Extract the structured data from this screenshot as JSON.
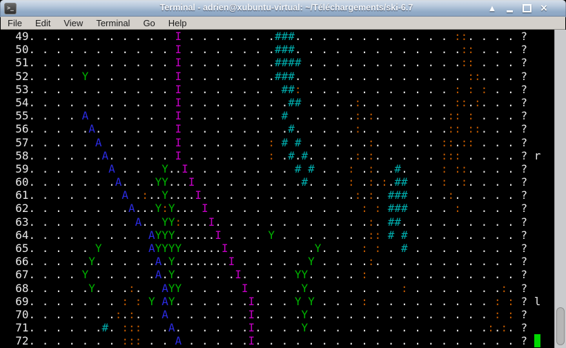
{
  "window": {
    "title": "Terminal - adrien@xubuntu-virtual: ~/Téléchargements/ski-6.7",
    "app_icon": "terminal-icon",
    "icon_glyph": ">_",
    "buttons": [
      "shade",
      "minimize",
      "maximize",
      "close"
    ]
  },
  "menu": {
    "items": [
      "File",
      "Edit",
      "View",
      "Terminal",
      "Go",
      "Help"
    ]
  },
  "terminal": {
    "palette": {
      "w": "#e8e8e8",
      "m": "#c400c4",
      "g": "#00b400",
      "b": "#2b2be0",
      "c": "#00adad",
      "o": "#c25a00",
      "cursor": "#00d800",
      "background": "#000000"
    },
    "legend": {
      "I": "skier",
      "A": "yeti",
      "Y": "tree",
      "#": "ice",
      ":": "bare-ground",
      ".": "snow",
      "?": "command-prompt"
    },
    "field": {
      "total_cols": 81,
      "num_width": 4,
      "dot_start": 4,
      "dot_end": 76,
      "snow_char": ".",
      "prompt_col": 78,
      "prompt_char": "?",
      "echo_col": 80
    },
    "rows": [
      {
        "num": 49,
        "cells": [
          [
            26,
            "m",
            "I"
          ],
          [
            41,
            "c",
            "###"
          ],
          [
            68,
            "o",
            "::"
          ]
        ]
      },
      {
        "num": 50,
        "cells": [
          [
            26,
            "m",
            "I"
          ],
          [
            41,
            "c",
            "###"
          ],
          [
            69,
            "o",
            "::"
          ]
        ]
      },
      {
        "num": 51,
        "cells": [
          [
            26,
            "m",
            "I"
          ],
          [
            41,
            "c",
            "####"
          ],
          [
            69,
            "o",
            "::"
          ]
        ]
      },
      {
        "num": 52,
        "cells": [
          [
            12,
            "g",
            "Y"
          ],
          [
            26,
            "m",
            "I"
          ],
          [
            41,
            "c",
            "###"
          ],
          [
            70,
            "o",
            "::"
          ]
        ]
      },
      {
        "num": 53,
        "cells": [
          [
            26,
            "m",
            "I"
          ],
          [
            42,
            "c",
            "##"
          ],
          [
            44,
            "o",
            ":"
          ],
          [
            68,
            "o",
            ":"
          ],
          [
            70,
            "o",
            ":"
          ],
          [
            72,
            "o",
            ":"
          ]
        ]
      },
      {
        "num": 54,
        "cells": [
          [
            26,
            "m",
            "I"
          ],
          [
            43,
            "c",
            "##"
          ],
          [
            53,
            "o",
            ":"
          ],
          [
            68,
            "o",
            "::"
          ],
          [
            71,
            "o",
            ":"
          ]
        ]
      },
      {
        "num": 55,
        "cells": [
          [
            12,
            "b",
            "A"
          ],
          [
            26,
            "m",
            "I"
          ],
          [
            42,
            "c",
            "#"
          ],
          [
            53,
            "o",
            ":"
          ],
          [
            55,
            "o",
            ":"
          ],
          [
            67,
            "o",
            "::"
          ],
          [
            70,
            "o",
            ":"
          ]
        ]
      },
      {
        "num": 56,
        "cells": [
          [
            13,
            "b",
            "A"
          ],
          [
            26,
            "m",
            "I"
          ],
          [
            43,
            "c",
            "#"
          ],
          [
            53,
            "o",
            ":"
          ],
          [
            67,
            "o",
            "::"
          ],
          [
            70,
            "o",
            "::"
          ]
        ]
      },
      {
        "num": 57,
        "cells": [
          [
            14,
            "b",
            "A"
          ],
          [
            26,
            "m",
            "I"
          ],
          [
            40,
            "o",
            ":"
          ],
          [
            42,
            "c",
            "#"
          ],
          [
            44,
            "c",
            "#"
          ],
          [
            55,
            "o",
            ":"
          ],
          [
            66,
            "o",
            "::"
          ],
          [
            69,
            "o",
            "::"
          ]
        ]
      },
      {
        "num": 58,
        "cells": [
          [
            15,
            "b",
            "A"
          ],
          [
            26,
            "m",
            "I"
          ],
          [
            40,
            "o",
            ":"
          ],
          [
            43,
            "c",
            "#"
          ],
          [
            45,
            "c",
            "#"
          ],
          [
            53,
            "o",
            ":"
          ],
          [
            55,
            "o",
            ":"
          ],
          [
            66,
            "o",
            "::"
          ],
          [
            68,
            "o",
            ":"
          ]
        ],
        "echo": "r"
      },
      {
        "num": 59,
        "cells": [
          [
            16,
            "b",
            "A"
          ],
          [
            24,
            "g",
            "Y"
          ],
          [
            25,
            "w",
            "."
          ],
          [
            27,
            "m",
            "I"
          ],
          [
            44,
            "c",
            "#"
          ],
          [
            46,
            "c",
            "#"
          ],
          [
            52,
            "o",
            ":"
          ],
          [
            55,
            "o",
            ":"
          ],
          [
            59,
            "c",
            "#"
          ],
          [
            66,
            "o",
            ":"
          ],
          [
            68,
            "o",
            "::"
          ]
        ]
      },
      {
        "num": 60,
        "cells": [
          [
            17,
            "b",
            "A"
          ],
          [
            23,
            "g",
            "YY"
          ],
          [
            25,
            "w",
            "."
          ],
          [
            27,
            "w",
            "."
          ],
          [
            28,
            "m",
            "I"
          ],
          [
            45,
            "c",
            "#"
          ],
          [
            52,
            "o",
            ":"
          ],
          [
            55,
            "o",
            ":"
          ],
          [
            57,
            "o",
            ":"
          ],
          [
            59,
            "c",
            "##"
          ],
          [
            66,
            "o",
            ":"
          ],
          [
            69,
            "o",
            ":"
          ]
        ]
      },
      {
        "num": 61,
        "cells": [
          [
            18,
            "b",
            "A"
          ],
          [
            21,
            "o",
            ":"
          ],
          [
            23,
            "w",
            "."
          ],
          [
            24,
            "g",
            "Y"
          ],
          [
            25,
            "w",
            "."
          ],
          [
            27,
            "w",
            "."
          ],
          [
            29,
            "m",
            "I"
          ],
          [
            53,
            "o",
            ":"
          ],
          [
            55,
            "o",
            ":"
          ],
          [
            58,
            "c",
            "###"
          ],
          [
            67,
            "o",
            ":"
          ]
        ]
      },
      {
        "num": 62,
        "cells": [
          [
            19,
            "b",
            "A"
          ],
          [
            21,
            "w",
            "."
          ],
          [
            23,
            "g",
            "Y"
          ],
          [
            24,
            "o",
            ":"
          ],
          [
            25,
            "g",
            "Y"
          ],
          [
            27,
            "w",
            "."
          ],
          [
            30,
            "m",
            "I"
          ],
          [
            54,
            "o",
            ":"
          ],
          [
            56,
            "o",
            ":"
          ],
          [
            58,
            "c",
            "###"
          ],
          [
            68,
            "o",
            ":"
          ]
        ]
      },
      {
        "num": 63,
        "cells": [
          [
            20,
            "b",
            "A"
          ],
          [
            21,
            "w",
            "."
          ],
          [
            24,
            "g",
            "YY"
          ],
          [
            26,
            "o",
            ":"
          ],
          [
            27,
            "w",
            "."
          ],
          [
            29,
            "w",
            "."
          ],
          [
            31,
            "m",
            "I"
          ],
          [
            55,
            "o",
            ":"
          ],
          [
            58,
            "c",
            "##"
          ]
        ]
      },
      {
        "num": 64,
        "cells": [
          [
            22,
            "b",
            "A"
          ],
          [
            23,
            "g",
            "YYY"
          ],
          [
            27,
            "w",
            "."
          ],
          [
            29,
            "w",
            "."
          ],
          [
            31,
            "w",
            "."
          ],
          [
            32,
            "m",
            "I"
          ],
          [
            40,
            "g",
            "Y"
          ],
          [
            55,
            "o",
            "::"
          ],
          [
            58,
            "c",
            "#"
          ],
          [
            60,
            "c",
            "#"
          ]
        ]
      },
      {
        "num": 65,
        "cells": [
          [
            14,
            "g",
            "Y"
          ],
          [
            22,
            "b",
            "A"
          ],
          [
            23,
            "g",
            "YYYY"
          ],
          [
            27,
            "w",
            "."
          ],
          [
            29,
            "w",
            "."
          ],
          [
            31,
            "w",
            "."
          ],
          [
            33,
            "m",
            "I"
          ],
          [
            47,
            "g",
            "Y"
          ],
          [
            54,
            "o",
            ":"
          ],
          [
            56,
            "o",
            ":"
          ],
          [
            60,
            "c",
            "#"
          ]
        ]
      },
      {
        "num": 66,
        "cells": [
          [
            13,
            "g",
            "Y"
          ],
          [
            23,
            "b",
            "A"
          ],
          [
            25,
            "g",
            "Y"
          ],
          [
            27,
            "w",
            "."
          ],
          [
            29,
            "w",
            "."
          ],
          [
            31,
            "w",
            "."
          ],
          [
            33,
            "w",
            "."
          ],
          [
            34,
            "m",
            "I"
          ],
          [
            46,
            "g",
            "Y"
          ],
          [
            55,
            "o",
            ":"
          ]
        ]
      },
      {
        "num": 67,
        "cells": [
          [
            12,
            "g",
            "Y"
          ],
          [
            23,
            "b",
            "A"
          ],
          [
            25,
            "g",
            "Y"
          ],
          [
            35,
            "m",
            "I"
          ],
          [
            44,
            "g",
            "YY"
          ],
          [
            54,
            "o",
            ":"
          ]
        ]
      },
      {
        "num": 68,
        "cells": [
          [
            13,
            "g",
            "Y"
          ],
          [
            19,
            "o",
            ":"
          ],
          [
            24,
            "b",
            "A"
          ],
          [
            25,
            "g",
            "YY"
          ],
          [
            36,
            "m",
            "I"
          ],
          [
            45,
            "g",
            "Y"
          ],
          [
            60,
            "o",
            ":"
          ],
          [
            75,
            "o",
            ":"
          ]
        ]
      },
      {
        "num": 69,
        "cells": [
          [
            18,
            "o",
            ":"
          ],
          [
            20,
            "o",
            ":"
          ],
          [
            22,
            "g",
            "Y"
          ],
          [
            24,
            "b",
            "A"
          ],
          [
            25,
            "g",
            "Y"
          ],
          [
            37,
            "m",
            "I"
          ],
          [
            44,
            "g",
            "Y"
          ],
          [
            46,
            "g",
            "Y"
          ],
          [
            54,
            "o",
            ":"
          ],
          [
            74,
            "o",
            ":"
          ],
          [
            76,
            "o",
            ":"
          ]
        ],
        "echo": "l"
      },
      {
        "num": 70,
        "cells": [
          [
            17,
            "o",
            ":"
          ],
          [
            19,
            "o",
            ":"
          ],
          [
            24,
            "b",
            "A"
          ],
          [
            37,
            "m",
            "I"
          ],
          [
            45,
            "g",
            "Y"
          ],
          [
            74,
            "o",
            ":"
          ],
          [
            76,
            "o",
            ":"
          ]
        ]
      },
      {
        "num": 71,
        "cells": [
          [
            15,
            "c",
            "#"
          ],
          [
            18,
            "o",
            ":::"
          ],
          [
            25,
            "b",
            "A"
          ],
          [
            37,
            "m",
            "I"
          ],
          [
            45,
            "g",
            "Y"
          ],
          [
            73,
            "o",
            ":"
          ],
          [
            75,
            "o",
            ":"
          ]
        ]
      },
      {
        "num": 72,
        "cells": [
          [
            18,
            "o",
            ":::"
          ],
          [
            26,
            "b",
            "A"
          ],
          [
            37,
            "m",
            "I"
          ]
        ],
        "cursor": true
      }
    ]
  }
}
